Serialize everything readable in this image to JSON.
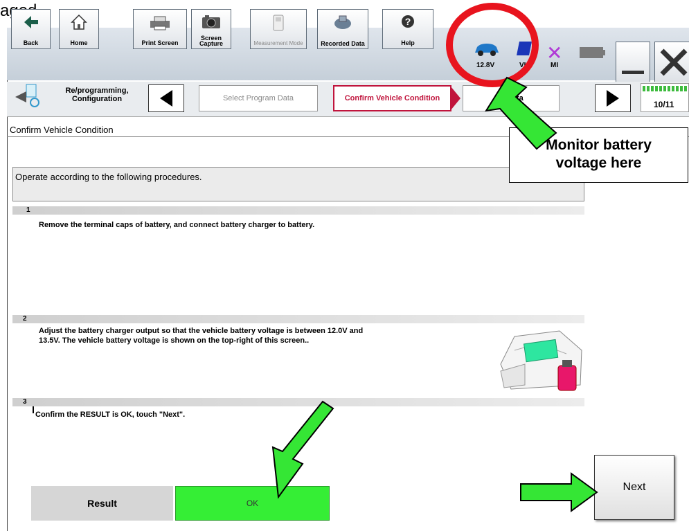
{
  "document": {
    "leading_text": "aged."
  },
  "toolbar": {
    "buttons": [
      {
        "label": "Back"
      },
      {
        "label": "Home"
      },
      {
        "label": "Print Screen"
      },
      {
        "label": "Screen Capture"
      },
      {
        "label": "Measurement Mode"
      },
      {
        "label": "Recorded Data"
      },
      {
        "label": "Help"
      }
    ],
    "status": {
      "voltage": "12.8V",
      "vi": "VI",
      "mi": "MI"
    }
  },
  "nav": {
    "function_label": "Re/programming, Configuration",
    "steps": [
      "Select Program Data",
      "Confirm Vehicle Condition",
      "Transfer Data"
    ],
    "transfer_visible": "Tra    ata",
    "page_counter": "10/11"
  },
  "screen": {
    "title": "Confirm Vehicle Condition",
    "instruction": "Operate according to the following procedures.",
    "steps": [
      {
        "number": "1",
        "text": "Remove the terminal caps of battery, and connect battery charger to battery."
      },
      {
        "number": "2",
        "text_line1": "Adjust the battery charger output so that the vehicle battery voltage is between 12.0V and",
        "text_line2": "13.5V. The vehicle battery voltage is shown on the top-right of this screen.."
      },
      {
        "number": "3",
        "text": "Confirm the RESULT is OK, touch \"Next\"."
      }
    ],
    "result_label": "Result",
    "result_value": "OK",
    "next_label": "Next"
  },
  "callout": {
    "line1": "Monitor battery",
    "line2": "voltage here"
  },
  "colors": {
    "highlight_circle": "#e8141e",
    "arrow_green": "#35e635",
    "ok_green": "#35ee35",
    "crumb_active": "#c0143c"
  }
}
